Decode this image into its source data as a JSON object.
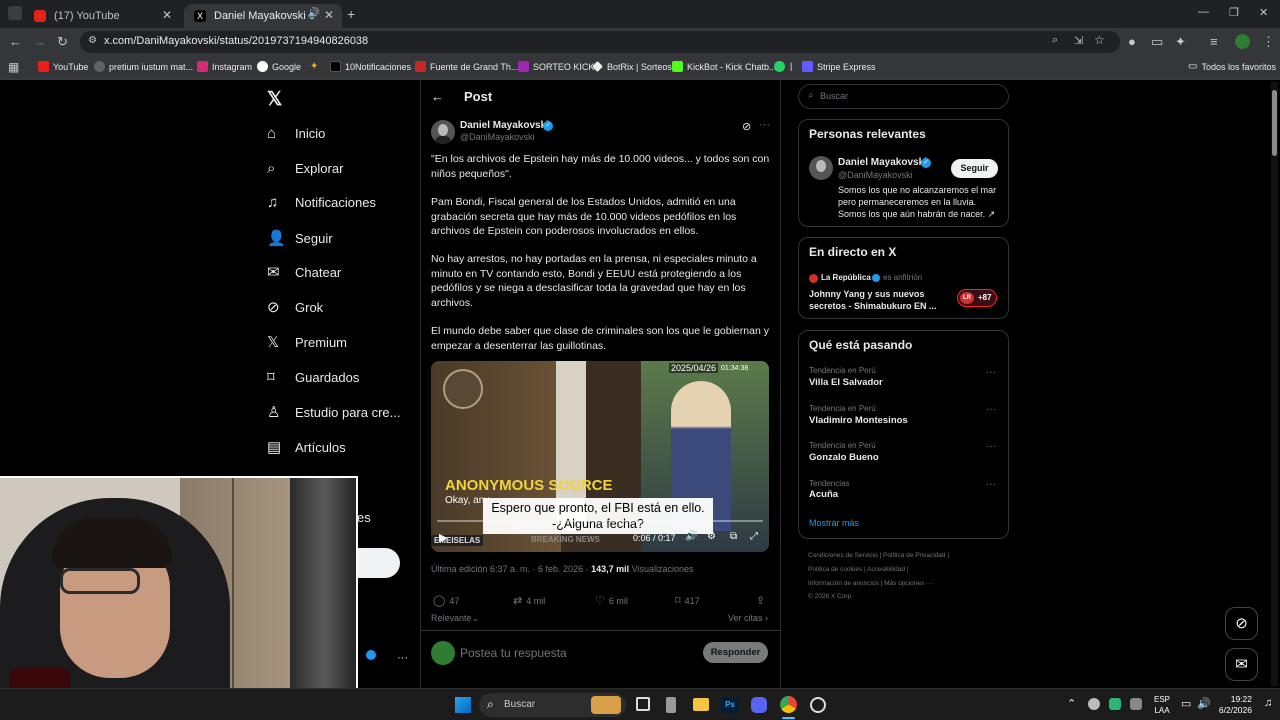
{
  "browser": {
    "tabs": [
      {
        "label": "(17) YouTube",
        "icon": "youtube-icon"
      },
      {
        "label": "Daniel Mayakovski en X: \"E",
        "icon": "x-logo-icon"
      }
    ],
    "new_tab": "+",
    "url": "x.com/DaniMayakovski/status/2019737194940826038",
    "bookmarks": [
      "YouTube",
      "pretium iustum mat...",
      "Instagram",
      "Google",
      "10Notificaciones",
      "Fuente de Grand Th...",
      "SORTEO KICK",
      "BotRix | Sorteos",
      "KickBot - Kick Chatb...",
      "|",
      "Stripe Express"
    ],
    "all_bookmarks": "Todos los favoritos"
  },
  "nav": {
    "items": [
      "Inicio",
      "Explorar",
      "Notificaciones",
      "Seguir",
      "Chatear",
      "Grok",
      "Premium",
      "Guardados",
      "Estudio para cre...",
      "Artículos"
    ],
    "partial_item": "es"
  },
  "post": {
    "header": "Post",
    "author_name": "Daniel Mayakovski",
    "author_handle": "@DaniMayakovski",
    "paragraphs": [
      "\"En los archivos de Epstein hay más de 10.000 videos... y todos son con niños pequeños\".",
      "Pam Bondi, Fiscal general de los Estados Unidos, admitió en una grabación secreta que hay más de 10.000 videos pedófilos en los archivos de Epstein con poderosos involucrados en ellos.",
      "No hay arrestos, no hay portadas en la prensa, ni especiales minuto a minuto en TV contando esto, Bondi y EEUU está protegiendo a los pedófilos y se niega a desclasificar toda la gravedad que hay en los archivos.",
      "El mundo debe saber que clase de criminales son los que le gobiernan y empezar a desenterrar las guillotinas."
    ],
    "video": {
      "timestamp_overlay": "2025/04/26",
      "time_small": "01:34:38",
      "anon_title": "ANONYMOUS SOURCE",
      "anon_sub": "Okay, any",
      "subtitle_line1": "Espero que pronto, el FBI está en ello.",
      "subtitle_line2": "-¿Alguna fecha?",
      "time": "0:06 / 0:17",
      "ticker_left": "EMEISELAS",
      "ticker_right": "BREAKING NEWS"
    },
    "meta_edit": "Última edición 6:37 a. m. · 6 feb. 2026 · ",
    "views_count": "143,7 mil",
    "views_label": " Visualizaciones",
    "actions": {
      "replies": "47",
      "reposts": "4 mil",
      "likes": "6 mil",
      "bookmarks": "417"
    },
    "relevant": "Relevante",
    "quotes": "Ver citas",
    "reply_placeholder": "Postea tu respuesta",
    "reply_button": "Responder"
  },
  "sidebar": {
    "search_placeholder": "Buscar",
    "relevant_title": "Personas relevantes",
    "person_name": "Daniel Mayakovski",
    "person_handle": "@DaniMayakovski",
    "follow": "Seguir",
    "bio": "Somos los que no alcanzaremos el mar pero permaneceremos en la lluvia. Somos los que aún habrán de nacer. ↗",
    "live_title": "En directo en X",
    "live_source": "La República",
    "live_host": "es anfitrión",
    "live_text": "Johnny Yang y sus nuevos secretos - Shimabukuro EN ...",
    "live_badge": "LR",
    "live_count": "+87",
    "trends_title": "Qué está pasando",
    "trends": [
      {
        "category": "Tendencia en Perú",
        "name": "Villa El Salvador"
      },
      {
        "category": "Tendencia en Perú",
        "name": "Vladimiro Montesinos"
      },
      {
        "category": "Tendencia en Perú",
        "name": "Gonzalo Bueno"
      },
      {
        "category": "Tendencias",
        "name": "Acuña"
      }
    ],
    "show_more": "Mostrar más",
    "footer": [
      "Condiciones de Servicio  |  Política de Privacidad  |",
      "Política de cookies  |  Accesibilidad  |",
      "Información de anuncios  |  Más opciones ···",
      "© 2026 X Corp."
    ]
  },
  "taskbar": {
    "search": "Buscar",
    "lang1": "ESP",
    "lang2": "LAA",
    "time": "19:22",
    "date": "6/2/2026"
  }
}
